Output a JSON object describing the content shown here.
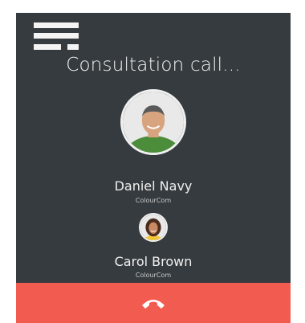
{
  "call": {
    "status": "Consultation call...",
    "primary_contact": {
      "name": "Daniel Navy",
      "company": "ColourCom"
    },
    "secondary_contact": {
      "name": "Carol Brown",
      "company": "ColourCom"
    }
  },
  "icons": {
    "menu": "menu-icon",
    "hangup": "phone-hangup-icon"
  },
  "colors": {
    "panel_bg": "#363b3f",
    "hangup_bg": "#f25b50",
    "text": "#f2f2f2"
  }
}
